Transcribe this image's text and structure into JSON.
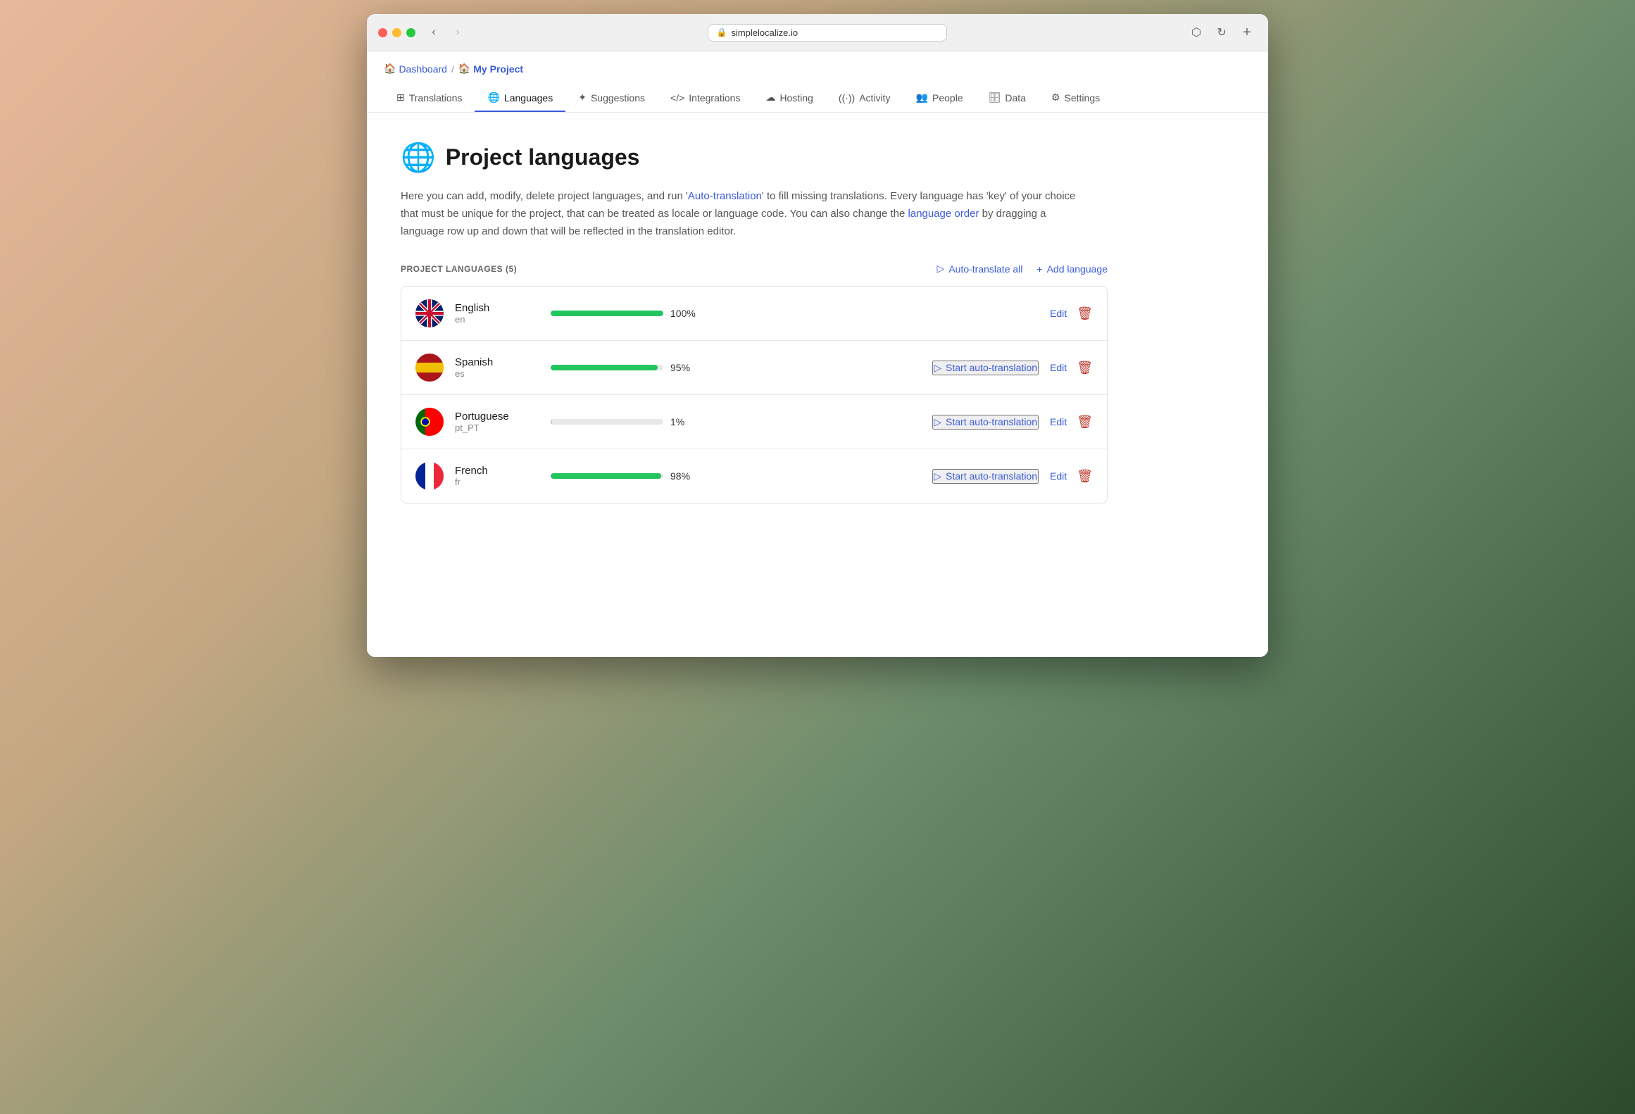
{
  "browser": {
    "url": "simplelocalize.io",
    "back_disabled": false,
    "forward_disabled": true
  },
  "breadcrumb": {
    "home_label": "Dashboard",
    "separator": "/",
    "project_emoji": "🏠",
    "current_label": "My Project",
    "current_emoji": "🏠"
  },
  "tabs": [
    {
      "id": "translations",
      "icon": "⊞",
      "label": "Translations",
      "active": false
    },
    {
      "id": "languages",
      "icon": "🌐",
      "label": "Languages",
      "active": true
    },
    {
      "id": "suggestions",
      "icon": "✦",
      "label": "Suggestions",
      "active": false
    },
    {
      "id": "integrations",
      "icon": "</>",
      "label": "Integrations",
      "active": false
    },
    {
      "id": "hosting",
      "icon": "☁",
      "label": "Hosting",
      "active": false
    },
    {
      "id": "activity",
      "icon": "((·))",
      "label": "Activity",
      "active": false
    },
    {
      "id": "people",
      "icon": "👥",
      "label": "People",
      "active": false
    },
    {
      "id": "data",
      "icon": "🗄",
      "label": "Data",
      "active": false
    },
    {
      "id": "settings",
      "icon": "⚙",
      "label": "Settings",
      "active": false
    }
  ],
  "page": {
    "title": "Project languages",
    "description_part1": "Here you can add, modify, delete project languages, and run '",
    "auto_translation_link": "Auto-translation",
    "description_part2": "' to fill missing translations. Every language has 'key' of your choice that must be unique for the project, that can be treated as locale or language code. You can also change the ",
    "language_order_link": "language order",
    "description_part3": " by dragging a language row up and down that will be reflected in the translation editor."
  },
  "languages_section": {
    "title": "PROJECT LANGUAGES (5)",
    "auto_translate_all_label": "Auto-translate all",
    "add_language_label": "Add language"
  },
  "languages": [
    {
      "id": "en",
      "name": "English",
      "code": "en",
      "flag_emoji": "🇬🇧",
      "flag_type": "uk",
      "progress": 100,
      "progress_color": "#22c55e",
      "show_auto_translate": false,
      "edit_label": "Edit",
      "delete_label": "Delete"
    },
    {
      "id": "es",
      "name": "Spanish",
      "code": "es",
      "flag_emoji": "🇪🇸",
      "flag_type": "es",
      "progress": 95,
      "progress_color": "#22c55e",
      "show_auto_translate": true,
      "auto_translate_label": "Start auto-translation",
      "edit_label": "Edit",
      "delete_label": "Delete"
    },
    {
      "id": "pt",
      "name": "Portuguese",
      "code": "pt_PT",
      "flag_emoji": "🇵🇹",
      "flag_type": "pt",
      "progress": 1,
      "progress_color": "#c8c8c8",
      "show_auto_translate": true,
      "auto_translate_label": "Start auto-translation",
      "edit_label": "Edit",
      "delete_label": "Delete"
    },
    {
      "id": "fr",
      "name": "French",
      "code": "fr",
      "flag_emoji": "🇫🇷",
      "flag_type": "fr",
      "progress": 98,
      "progress_color": "#22c55e",
      "show_auto_translate": true,
      "auto_translate_label": "Start auto-translation",
      "edit_label": "Edit",
      "delete_label": "Delete"
    }
  ]
}
